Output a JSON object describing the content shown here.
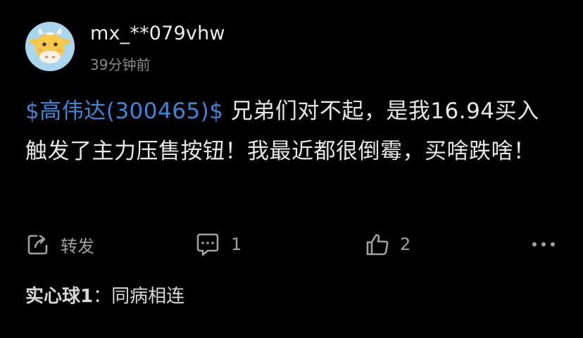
{
  "user": {
    "username": "mx_**079vhw",
    "timestamp": "39分钟前",
    "avatar_icon": "cow-icon"
  },
  "post": {
    "stock_tag": "$高伟达(300465)$",
    "text": " 兄弟们对不起，是我16.94买入触发了主力压售按钮！我最近都很倒霉，买啥跌啥！"
  },
  "actions": {
    "repost_label": "转发",
    "comment_count": "1",
    "like_count": "2"
  },
  "reply": {
    "user": "实心球1",
    "separator": "：",
    "text": "同病相连"
  },
  "colors": {
    "background": "#000000",
    "link": "#3f86d8",
    "secondary_text": "#8a8a8a",
    "avatar_bg": "#a9d5ef"
  }
}
